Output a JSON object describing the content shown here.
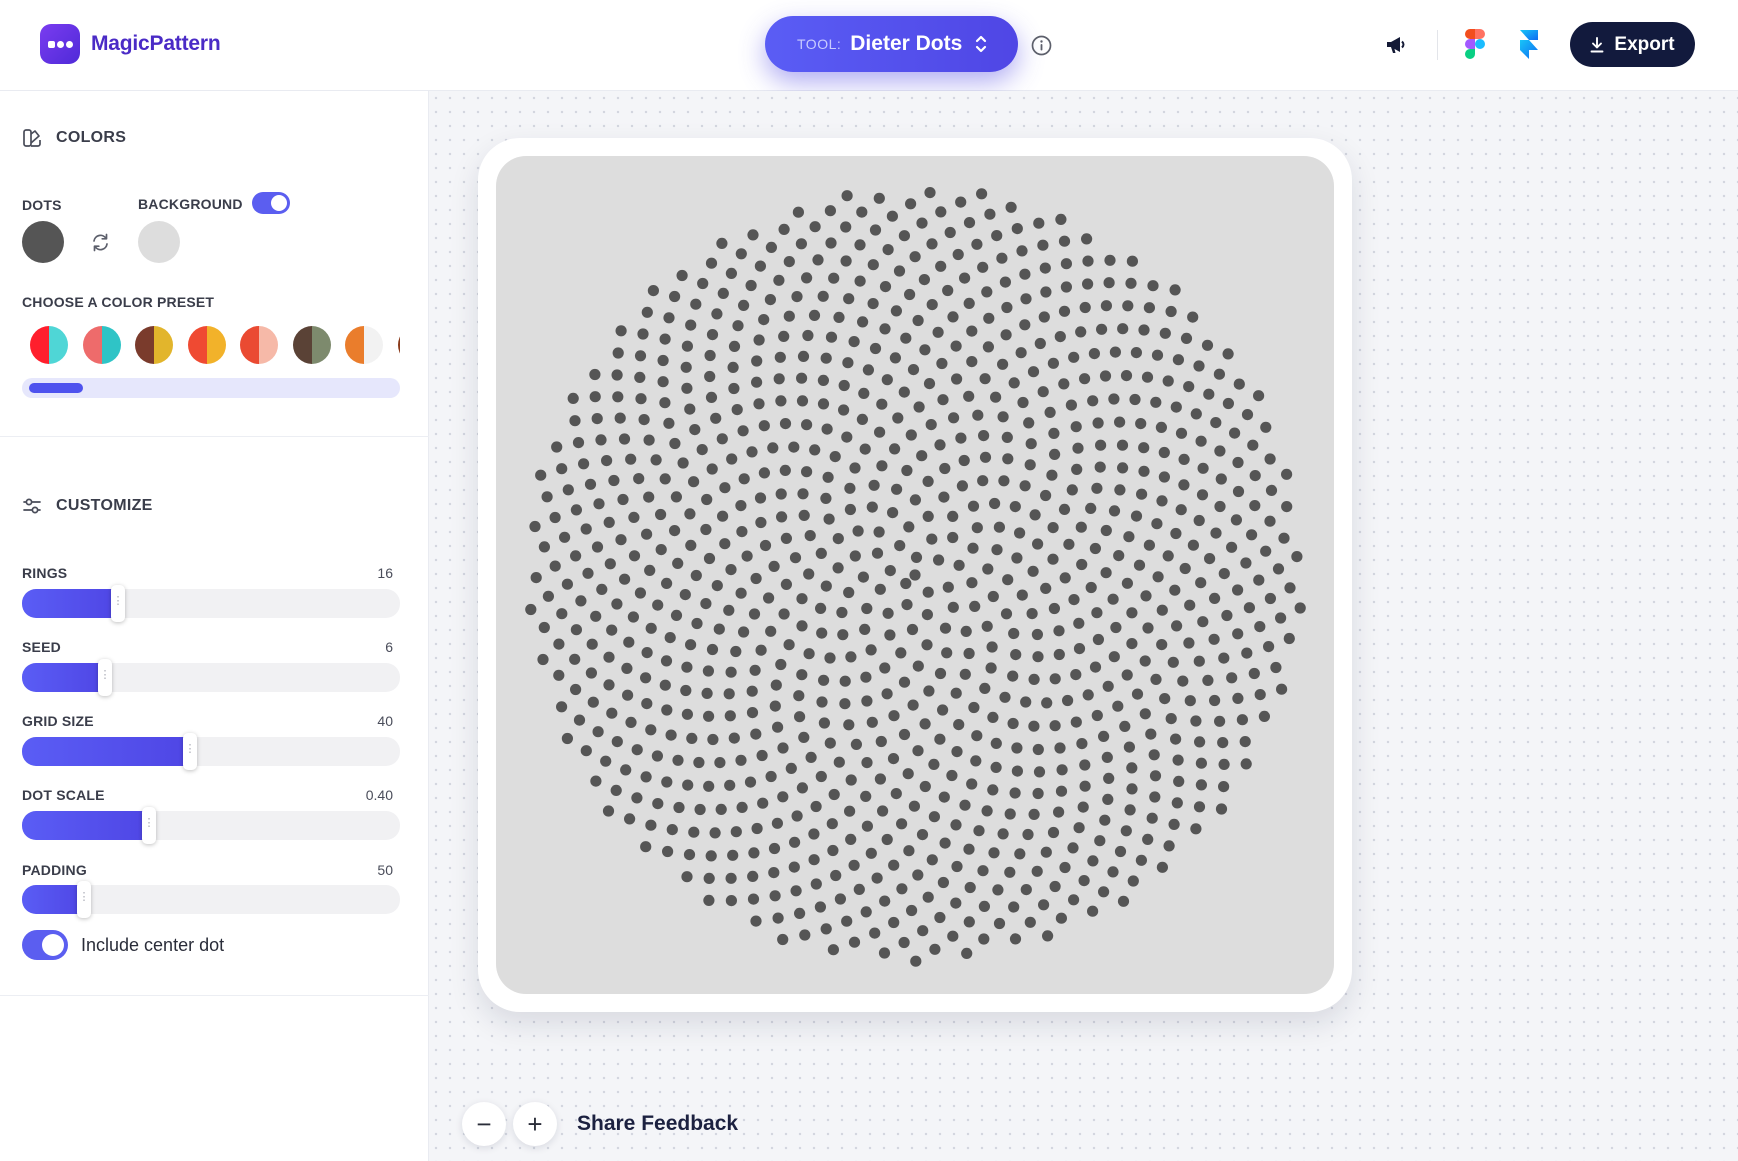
{
  "brand": {
    "name": "MagicPattern"
  },
  "tool": {
    "prefix": "TOOL:",
    "name": "Dieter Dots"
  },
  "header": {
    "export_label": "Export"
  },
  "colors": {
    "title": "COLORS",
    "dots_label": "DOTS",
    "background_label": "BACKGROUND",
    "background_enabled": true,
    "dot_color": "#555555",
    "background_color": "#dddddd",
    "preset_label": "CHOOSE A COLOR PRESET",
    "presets": [
      [
        "#ff1f2d",
        "#4fd6d6"
      ],
      [
        "#ee6b6b",
        "#2fc4c6"
      ],
      [
        "#7a3b2c",
        "#e2b52c"
      ],
      [
        "#ef4a32",
        "#f2b22a"
      ],
      [
        "#ea4a32",
        "#f6b9a8"
      ],
      [
        "#5a4236",
        "#7d8a6d"
      ],
      [
        "#ea7d2c",
        "#f2f2f2"
      ],
      [
        "#8a3a1a",
        "#f2f2f2"
      ]
    ]
  },
  "customize": {
    "title": "CUSTOMIZE",
    "sliders": [
      {
        "label": "RINGS",
        "value": "16",
        "fraction": 0.255
      },
      {
        "label": "SEED",
        "value": "6",
        "fraction": 0.22
      },
      {
        "label": "GRID SIZE",
        "value": "40",
        "fraction": 0.445
      },
      {
        "label": "DOT SCALE",
        "value": "0.40",
        "fraction": 0.335
      },
      {
        "label": "PADDING",
        "value": "50",
        "fraction": 0.165
      }
    ],
    "center_dot_label": "Include center dot",
    "center_dot_enabled": true
  },
  "canvas": {
    "share_feedback": "Share Feedback",
    "zoom_out": "−",
    "zoom_in": "+"
  }
}
